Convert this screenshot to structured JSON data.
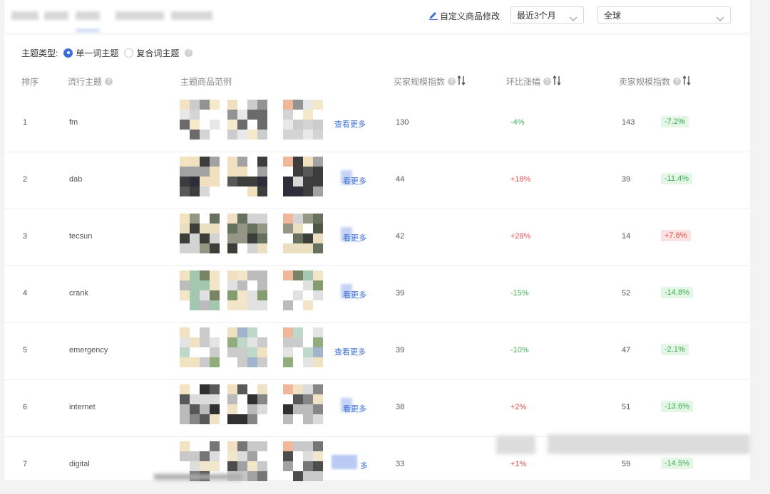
{
  "toolbar": {
    "edit_label": "自定义商品修改",
    "time_range": "最近3个月",
    "region": "全球"
  },
  "filter": {
    "label": "主题类型:",
    "options": [
      "单一词主题",
      "复合词主题"
    ],
    "selected": "单一词主题"
  },
  "table": {
    "headers": {
      "rank": "排序",
      "theme": "流行主题",
      "examples": "主题商品范例",
      "buyer_index": "买家规模指数",
      "change": "环比涨幅",
      "seller_index": "卖家规模指数"
    },
    "more_label": "查看更多",
    "rows": [
      {
        "rank": "1",
        "theme": "fm",
        "more": "查看更多",
        "buyer": "130",
        "change": "-4%",
        "change_dir": "neg",
        "seller": "143",
        "seller_change": "-7.2%",
        "seller_dir": "neg"
      },
      {
        "rank": "2",
        "theme": "dab",
        "more": "看更多",
        "buyer": "44",
        "change": "+18%",
        "change_dir": "pos",
        "seller": "39",
        "seller_change": "-11.4%",
        "seller_dir": "neg"
      },
      {
        "rank": "3",
        "theme": "tecsun",
        "more": "看更多",
        "buyer": "42",
        "change": "+28%",
        "change_dir": "pos",
        "seller": "14",
        "seller_change": "+7.6%",
        "seller_dir": "pos"
      },
      {
        "rank": "4",
        "theme": "crank",
        "more": "看更多",
        "buyer": "39",
        "change": "-15%",
        "change_dir": "neg",
        "seller": "52",
        "seller_change": "-14.8%",
        "seller_dir": "neg"
      },
      {
        "rank": "5",
        "theme": "emergency",
        "more": "查看更多",
        "buyer": "39",
        "change": "-10%",
        "change_dir": "neg",
        "seller": "47",
        "seller_change": "-2.1%",
        "seller_dir": "neg"
      },
      {
        "rank": "6",
        "theme": "internet",
        "more": "看更多",
        "buyer": "38",
        "change": "+2%",
        "change_dir": "pos",
        "seller": "51",
        "seller_change": "-13.6%",
        "seller_dir": "neg"
      },
      {
        "rank": "7",
        "theme": "digital",
        "more": "多",
        "buyer": "33",
        "change": "+1%",
        "change_dir": "pos",
        "seller": "59",
        "seller_change": "-14.5%",
        "seller_dir": "neg"
      }
    ]
  },
  "colors": {
    "accent": "#3a6fd8",
    "negative": "#45b45a",
    "positive": "#e25555"
  },
  "icons": {
    "edit": "pencil-icon",
    "dropdown": "chevron-down-icon",
    "help": "question-circle-icon",
    "sort": "sort-arrows-icon"
  }
}
